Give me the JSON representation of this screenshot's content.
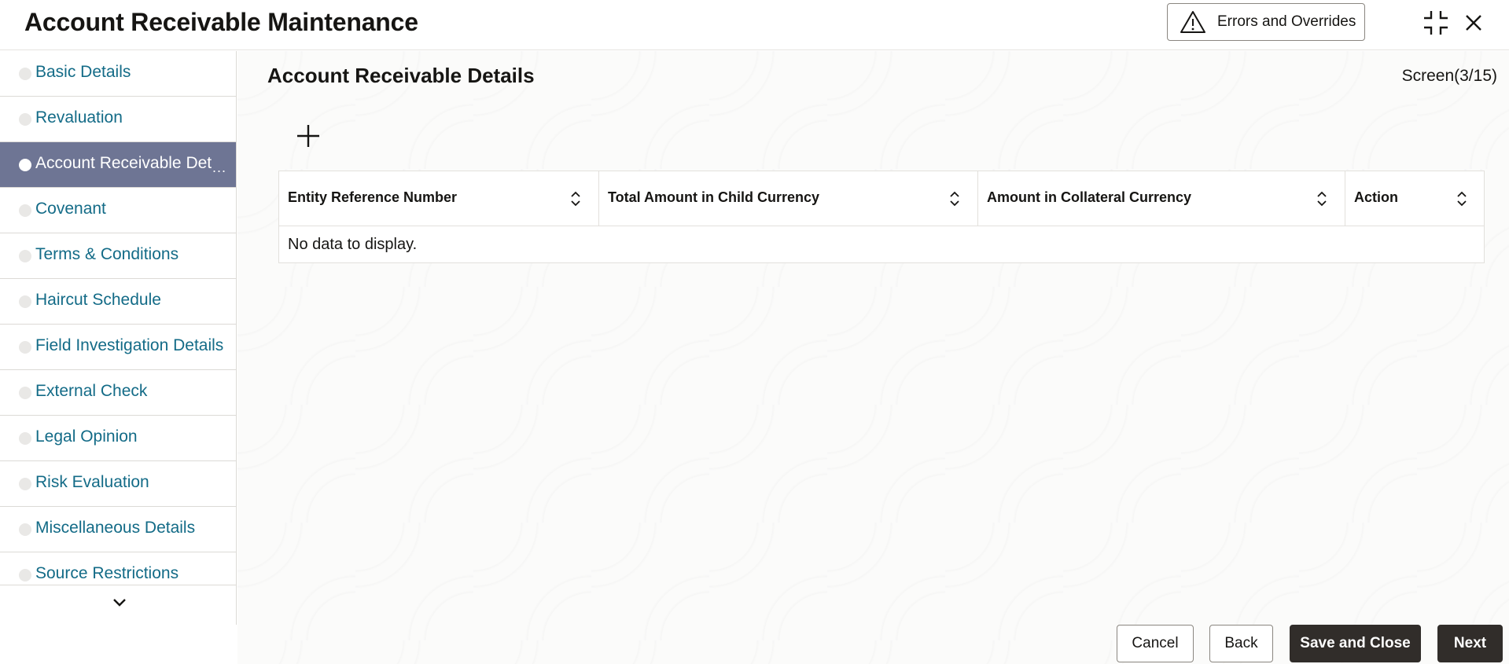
{
  "header": {
    "title": "Account Receivable Maintenance",
    "errors_button_label": "Errors and Overrides"
  },
  "sidebar": {
    "items": [
      {
        "label": "Basic Details",
        "active": false
      },
      {
        "label": "Revaluation",
        "active": false
      },
      {
        "label": "Account Receivable Det",
        "active": true
      },
      {
        "label": "Covenant",
        "active": false
      },
      {
        "label": "Terms & Conditions",
        "active": false
      },
      {
        "label": "Haircut Schedule",
        "active": false
      },
      {
        "label": "Field Investigation Details",
        "active": false
      },
      {
        "label": "External Check",
        "active": false
      },
      {
        "label": "Legal Opinion",
        "active": false
      },
      {
        "label": "Risk Evaluation",
        "active": false
      },
      {
        "label": "Miscellaneous Details",
        "active": false
      },
      {
        "label": "Source Restrictions",
        "active": false
      }
    ],
    "active_more": "..."
  },
  "main": {
    "section_title": "Account Receivable Details",
    "screen_indicator": "Screen(3/15)",
    "table": {
      "columns": [
        "Entity Reference Number",
        "Total Amount in Child Currency",
        "Amount in Collateral Currency",
        "Action"
      ],
      "empty_message": "No data to display."
    }
  },
  "footer": {
    "cancel_label": "Cancel",
    "back_label": "Back",
    "save_close_label": "Save and Close",
    "next_label": "Next"
  },
  "colors": {
    "accent_link": "#136b87",
    "active_nav": "#6e7594",
    "primary_button": "#312d2a"
  }
}
